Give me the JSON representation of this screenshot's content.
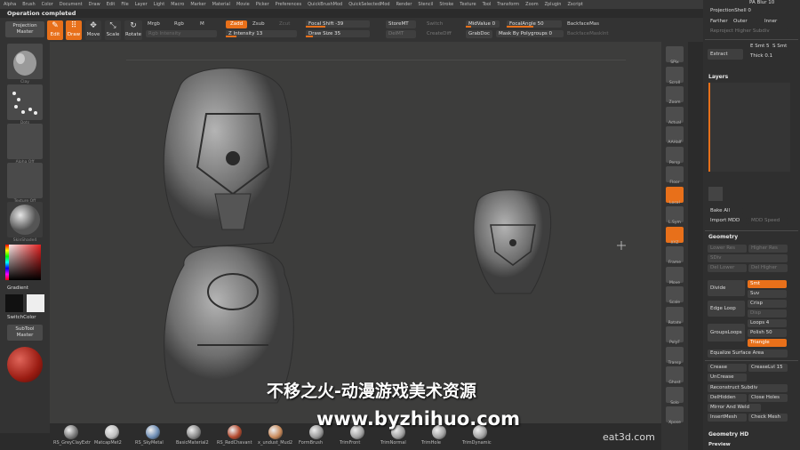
{
  "menu": [
    "Alpha",
    "Brush",
    "Color",
    "Document",
    "Draw",
    "Edit",
    "File",
    "Layer",
    "Light",
    "Macro",
    "Marker",
    "Material",
    "Movie",
    "Picker",
    "Preferences",
    "QuickBrushMod",
    "QuickSelectedMod",
    "Render",
    "Stencil",
    "Stroke",
    "Texture",
    "Tool",
    "Transform",
    "Zoom",
    "Zplugin",
    "Zscript"
  ],
  "status": "Operation completed",
  "toolbar": {
    "projection_master": "Projection\nMaster",
    "edit": "Edit",
    "draw": "Draw",
    "move": "Move",
    "scale": "Scale",
    "rotate": "Rotate",
    "mrgb": "Mrgb",
    "rgb": "Rgb",
    "m": "M",
    "rgb_intensity": "Rgb Intensity",
    "zadd": "Zadd",
    "zsub": "Zsub",
    "zcut": "Zcut",
    "z_intensity": "Z Intensity 13",
    "focal_shift": "Focal Shift -39",
    "draw_size": "Draw Size 35",
    "storemt": "StoreMT",
    "delmt": "DelMT",
    "switch": "Switch",
    "creatediff": "CreateDiff",
    "midvalue": "MidValue 0",
    "grabdoc": "GrabDoc",
    "focal_angle": "FocalAngle 50",
    "mask_by_polygroups": "Mask By Polygroups 0",
    "backfacemask": "BackfaceMas",
    "backfacemaskint": "BackfaceMaskInt"
  },
  "left": {
    "brush_label": "Clay",
    "stroke_label": "Dots",
    "alpha_label": "Alpha Off",
    "texture_label": "Texture Off",
    "material_label": "SkinShade4",
    "gradient": "Gradient",
    "switchcolor": "SwitchColor",
    "subtool_master": "SubTool\nMaster"
  },
  "right_shelf": [
    "SPix",
    "Scroll",
    "Zoom",
    "Actual",
    "AAHalf",
    "Persp",
    "Floor",
    "Local",
    "L.Sym",
    "XYZ",
    "Frame",
    "Move",
    "Scale",
    "Rotate",
    "PolyF",
    "Transp",
    "Ghost",
    "Solo",
    "Xpose"
  ],
  "right_panel": {
    "pa_blur": "PA Blur 10",
    "projection_shell": "ProjectionShell 0",
    "farther": "Farther",
    "outer": "Outer",
    "inner": "Inner",
    "reproject": "Reproject Higher Subdiv",
    "extract": "Extract",
    "e_smt": "E Smt 5",
    "s_smt": "S Smt",
    "thick": "Thick 0.1",
    "layers_title": "Layers",
    "bake_all": "Bake All",
    "import_mdd": "Import MDD",
    "mdd_speed": "MDD Speed",
    "geometry_title": "Geometry",
    "lower_res": "Lower Res",
    "higher_res": "Higher Res",
    "sdiv": "SDiv",
    "del_lower": "Del Lower",
    "del_higher": "Del Higher",
    "divide": "Divide",
    "smt": "Smt",
    "suv": "Suv",
    "edge_loop": "Edge Loop",
    "crisp": "Crisp",
    "disp": "Disp",
    "groupsloops": "GroupsLoops",
    "loops": "Loops 4",
    "polish": "Polish 50",
    "triangle": "Triangle",
    "equalize": "Equalize Surface Area",
    "crease": "Crease",
    "creaselvl": "CreaseLvl 15",
    "uncrease": "UnCrease",
    "reconstruct": "Reconstruct Subdiv",
    "delhidden": "DelHidden",
    "close_holes": "Close Holes",
    "mirror_weld": "Mirror And Weld",
    "insertmesh": "InsertMesh",
    "check_mesh": "Check Mesh",
    "geometry_hd": "Geometry HD",
    "preview": "Preview"
  },
  "materials": [
    {
      "name": "RS_GreyClayExtr",
      "color": "#7a7a7a"
    },
    {
      "name": "MatcapMet2",
      "color": "#bdbdbd"
    },
    {
      "name": "RS_SkyMetal",
      "color": "#6d8db5"
    },
    {
      "name": "BasicMaterial2",
      "color": "#8a8a8a"
    },
    {
      "name": "RS_RedChavant",
      "color": "#b44a2e"
    },
    {
      "name": "x_undust_Mud2",
      "color": "#c98a5a"
    },
    {
      "name": "FormBrush",
      "color": "#9a9a9a"
    },
    {
      "name": "TrimFront",
      "color": "#a3a3a3"
    },
    {
      "name": "TrimNormal",
      "color": "#a3a3a3"
    },
    {
      "name": "TrimHole",
      "color": "#a3a3a3"
    },
    {
      "name": "TrimDynamic",
      "color": "#a3a3a3"
    }
  ],
  "watermark": {
    "line1": "不移之火-动漫游戏美术资源",
    "line2": "www.byzhihuo.com",
    "brand": "eat3d.com"
  },
  "colors": {
    "accent": "#e8701a",
    "background": "#2b2b2b",
    "canvas": "#3d3d3c"
  }
}
